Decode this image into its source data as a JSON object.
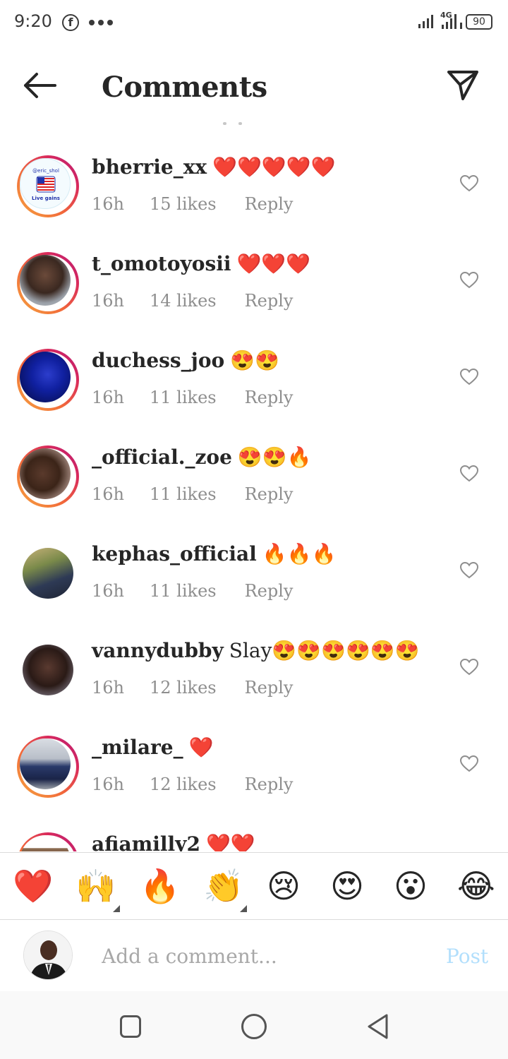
{
  "status_bar": {
    "time": "9:20",
    "facebook_icon": "f",
    "network": "4G",
    "battery": "90"
  },
  "header": {
    "title": "Comments"
  },
  "comments": [
    {
      "user": "bherrie_xx",
      "text": "❤️❤️❤️❤️❤️",
      "time": "16h",
      "likes": "15 likes",
      "reply": "Reply",
      "avatar_ring": true
    },
    {
      "user": "t_omotoyosii",
      "text": "❤️❤️❤️",
      "time": "16h",
      "likes": "14 likes",
      "reply": "Reply",
      "avatar_ring": true
    },
    {
      "user": "duchess_joo",
      "text": "😍😍",
      "time": "16h",
      "likes": "11 likes",
      "reply": "Reply",
      "avatar_ring": true
    },
    {
      "user": "_official._zoe",
      "text": "😍😍🔥",
      "time": "16h",
      "likes": "11 likes",
      "reply": "Reply",
      "avatar_ring": true
    },
    {
      "user": "kephas_official",
      "text": "🔥🔥🔥",
      "time": "16h",
      "likes": "11 likes",
      "reply": "Reply",
      "avatar_ring": false
    },
    {
      "user": "vannydubby",
      "text": "Slay😍😍😍😍😍😍",
      "time": "16h",
      "likes": "12 likes",
      "reply": "Reply",
      "avatar_ring": false
    },
    {
      "user": "_milare_",
      "text": "❤️",
      "time": "16h",
      "likes": "12 likes",
      "reply": "Reply",
      "avatar_ring": true
    },
    {
      "user": "afiamilly2",
      "text": "❤️❤️",
      "time": "",
      "likes": "",
      "reply": "",
      "avatar_ring": true
    }
  ],
  "avatar_badge": {
    "handle": "@eric_shol",
    "caption": "Live gains"
  },
  "emoji_bar": [
    "❤️",
    "🙌",
    "🔥",
    "👏",
    "😢",
    "😍",
    "😮",
    "😂"
  ],
  "composer": {
    "placeholder": "Add a comment...",
    "post_label": "Post"
  },
  "colors": {
    "accent_post_disabled": "#b2dffc",
    "secondary_text": "#8e8e8e",
    "story_ring_start": "#f5a640",
    "story_ring_end": "#b11d7a"
  }
}
